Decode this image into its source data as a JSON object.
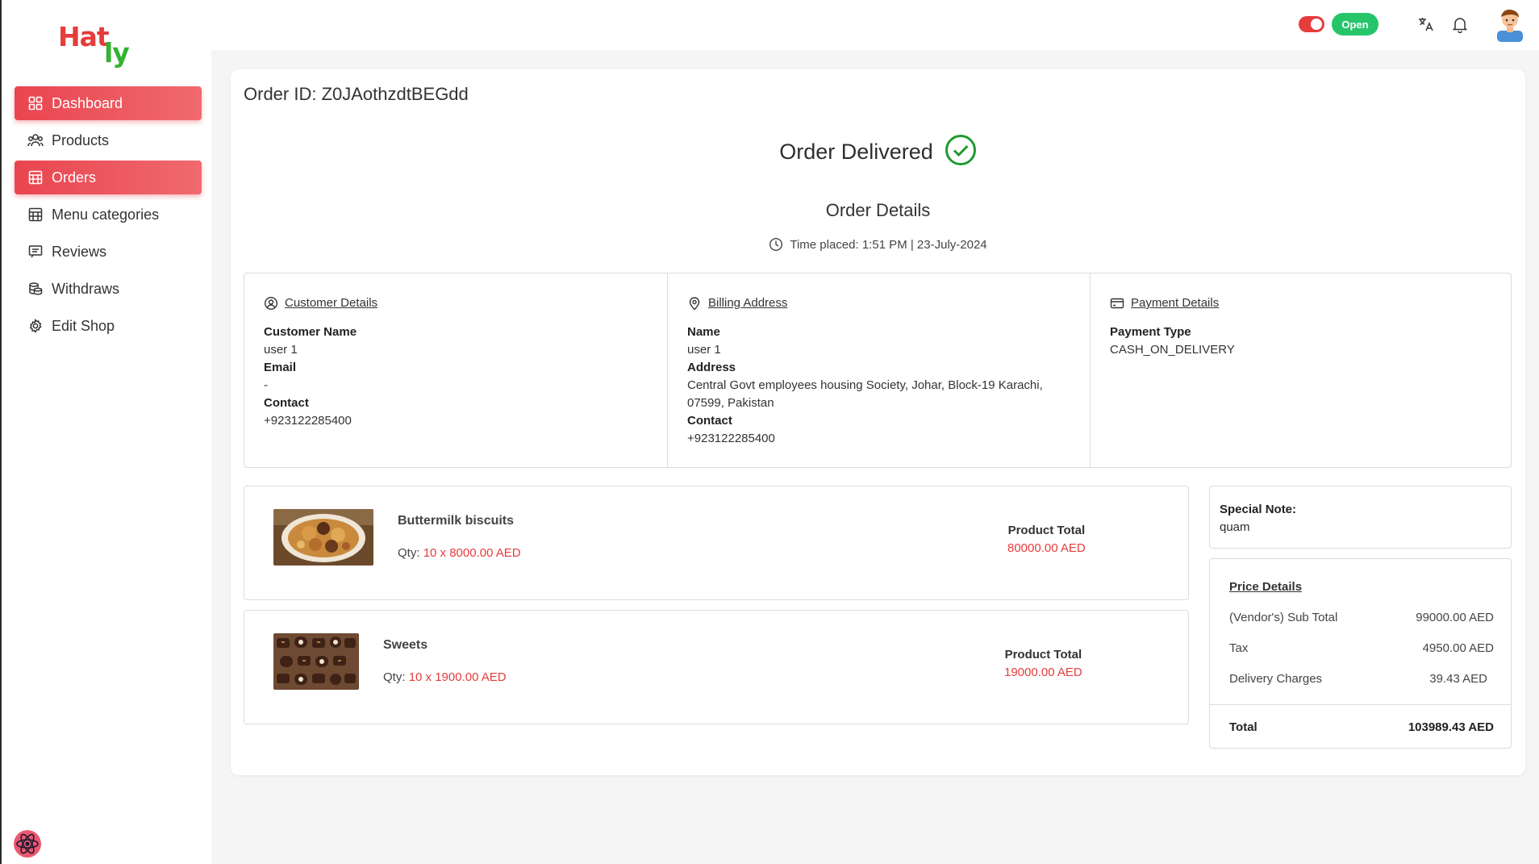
{
  "brand": {
    "part1": "Hat",
    "part2": "ly",
    "color1": "#e53c3c",
    "color2": "#34b233"
  },
  "sidebar": {
    "items": [
      {
        "label": "Dashboard",
        "icon": "dashboard-icon",
        "active": true
      },
      {
        "label": "Products",
        "icon": "users-group-icon",
        "active": false
      },
      {
        "label": "Orders",
        "icon": "store-icon",
        "active": true
      },
      {
        "label": "Menu categories",
        "icon": "store-icon",
        "active": false
      },
      {
        "label": "Reviews",
        "icon": "message-icon",
        "active": false
      },
      {
        "label": "Withdraws",
        "icon": "coins-icon",
        "active": false
      },
      {
        "label": "Edit Shop",
        "icon": "gear-icon",
        "active": false
      }
    ]
  },
  "topbar": {
    "status_label": "Open",
    "accent": "#e53c3c",
    "status_color": "#27c56a"
  },
  "order": {
    "id_text": "Order ID: Z0JAothzdtBEGdd",
    "status": "Order Delivered",
    "details_title": "Order Details",
    "time_placed": "Time placed: 1:51 PM | 23-July-2024"
  },
  "customer": {
    "heading": "Customer Details",
    "name_label": "Customer Name",
    "name": "user 1",
    "email_label": "Email",
    "email": "-",
    "contact_label": "Contact",
    "contact": "+923122285400"
  },
  "billing": {
    "heading": "Billing Address",
    "name_label": "Name",
    "name": "user 1",
    "address_label": "Address",
    "address_line1": "Central Govt employees housing Society, Johar, Block-19 Karachi,",
    "address_line2": "07599, Pakistan",
    "contact_label": "Contact",
    "contact": "+923122285400"
  },
  "payment": {
    "heading": "Payment Details",
    "type_label": "Payment Type",
    "type": "CASH_ON_DELIVERY"
  },
  "products": [
    {
      "name": "Buttermilk biscuits",
      "qty_label": "Qty:",
      "qty_value": "10 x 8000.00 AED",
      "total_label": "Product Total",
      "total": "80000.00 AED"
    },
    {
      "name": "Sweets",
      "qty_label": "Qty:",
      "qty_value": "10 x 1900.00 AED",
      "total_label": "Product Total",
      "total": "19000.00 AED"
    }
  ],
  "special_note": {
    "label": "Special Note:",
    "text": "quam"
  },
  "price": {
    "heading": "Price Details",
    "rows": [
      {
        "label": "(Vendor's) Sub Total",
        "value": "99000.00 AED"
      },
      {
        "label": "Tax",
        "value": "4950.00 AED"
      },
      {
        "label": "Delivery Charges",
        "value": "39.43 AED"
      }
    ],
    "total_label": "Total",
    "total_value": "103989.43 AED"
  }
}
